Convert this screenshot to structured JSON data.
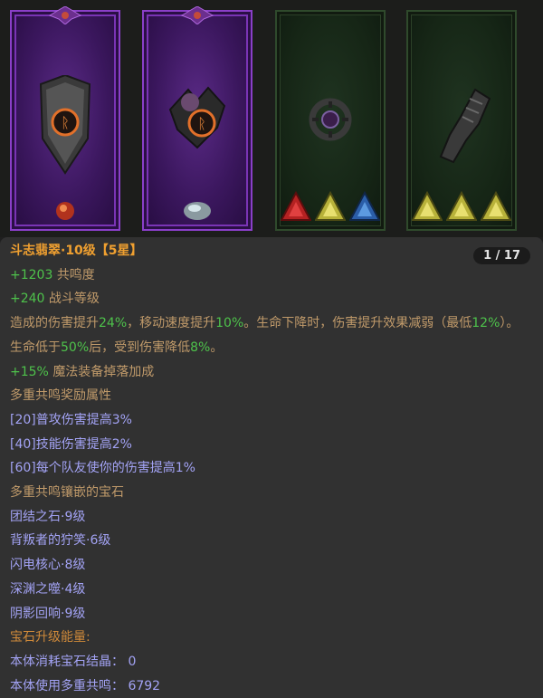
{
  "item": {
    "title": "斗志翡翠·10级【5星】",
    "page_indicator": "1 / 17",
    "stat1_value": "+1203",
    "stat1_label": "共鸣度",
    "stat2_value": "+240",
    "stat2_label": "战斗等级",
    "desc": {
      "p1": "造成的伤害提升",
      "v1": "24%",
      "p2": "，移动速度提升",
      "v2": "10%",
      "p3": "。生命下降时，伤害提升效果减弱（最低",
      "v3": "12%",
      "p4": "）。生命低于",
      "v4": "50%",
      "p5": "后，受到伤害降低",
      "v5": "8%",
      "p6": "。"
    },
    "magic_value": "+15%",
    "magic_label": "魔法装备掉落加成",
    "resonance_bonus_header": "多重共鸣奖励属性",
    "resonance_bonuses": [
      "[20]普攻伤害提高3%",
      "[40]技能伤害提高2%",
      "[60]每个队友使你的伤害提高1%"
    ],
    "inlaid_header": "多重共鸣镶嵌的宝石",
    "inlaid_gems": [
      "团结之石·9级",
      "背叛者的狞笑·6级",
      "闪电核心·8级",
      "深渊之噬·4级",
      "阴影回响·9级"
    ],
    "upgrade_header": "宝石升级能量:",
    "consume_label": "本体消耗宝石结晶：",
    "consume_value": "0",
    "resonance_use_label": "本体使用多重共鸣：",
    "resonance_use_value": "6792"
  },
  "icons": {
    "card1": "shield-rune-icon",
    "card2": "rose-rune-icon",
    "card3": "ring-icon",
    "card4": "gauntlet-icon"
  },
  "colors": {
    "title": "#f0a030",
    "green": "#4ec24b",
    "label": "#c09a6a",
    "blue": "#a3a3f5",
    "panel": "#313131",
    "purple_frame": "#8a3fc8"
  }
}
